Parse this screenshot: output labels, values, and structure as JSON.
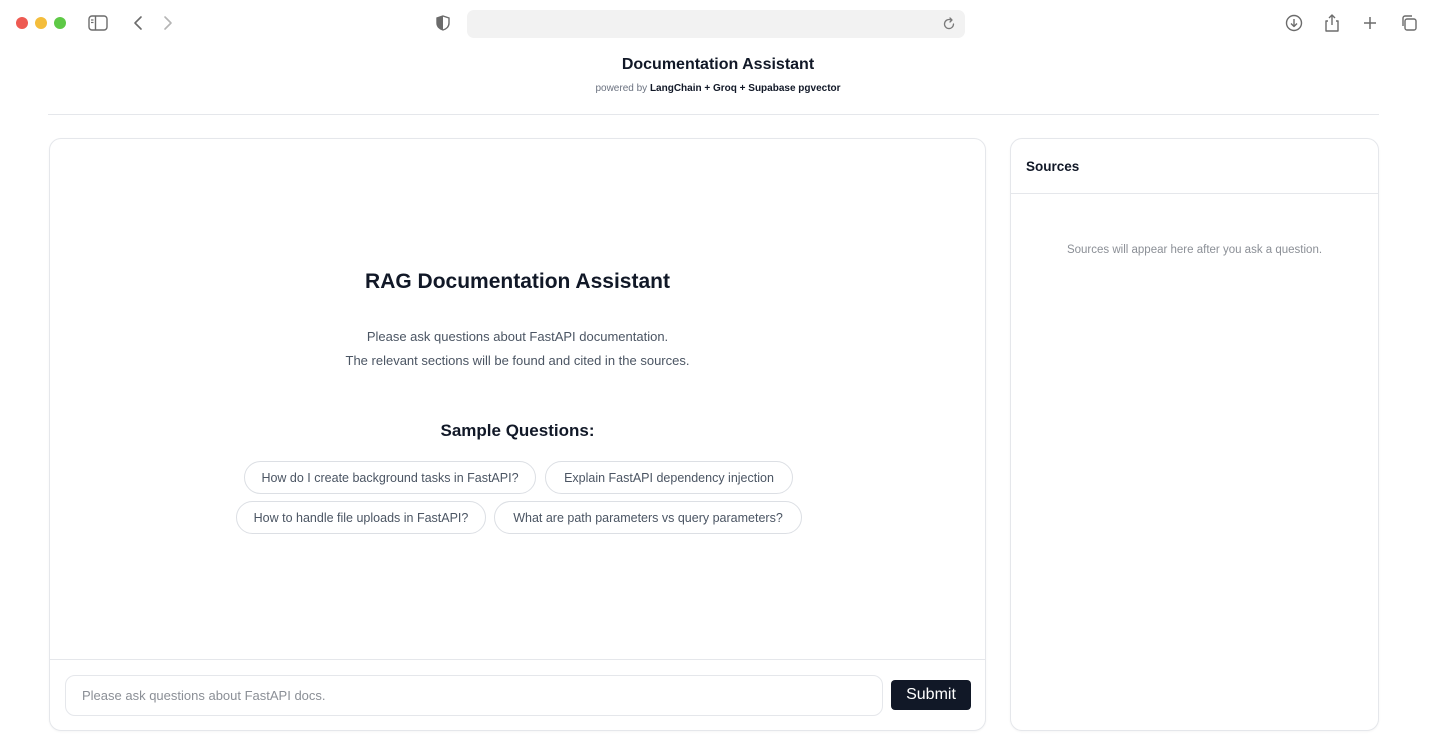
{
  "browser": {
    "address_value": "",
    "icons": [
      "sidebar-icon",
      "back-icon",
      "forward-icon",
      "shield-icon",
      "reload-icon",
      "download-icon",
      "share-icon",
      "new-tab-icon",
      "tabs-overview-icon"
    ]
  },
  "header": {
    "title": "Documentation Assistant",
    "powered_prefix": "powered by",
    "powered_stack": "LangChain + Groq + Supabase pgvector"
  },
  "chat": {
    "hero_title": "RAG Documentation Assistant",
    "hero_line1": "Please ask questions about FastAPI documentation.",
    "hero_line2": "The relevant sections will be found and cited in the sources.",
    "sample_title": "Sample Questions:",
    "samples": [
      "How do I create background tasks in FastAPI?",
      "Explain FastAPI dependency injection",
      "How to handle file uploads in FastAPI?",
      "What are path parameters vs query parameters?"
    ],
    "input_placeholder": "Please ask questions about FastAPI docs.",
    "input_value": "",
    "submit_label": "Submit"
  },
  "sources": {
    "title": "Sources",
    "empty_text": "Sources will appear here after you ask a question."
  },
  "colors": {
    "accent_dark": "#111827",
    "border": "#e5e7eb",
    "traffic_red": "#ee5a52",
    "traffic_yellow": "#f4bd3b",
    "traffic_green": "#5ec946"
  }
}
